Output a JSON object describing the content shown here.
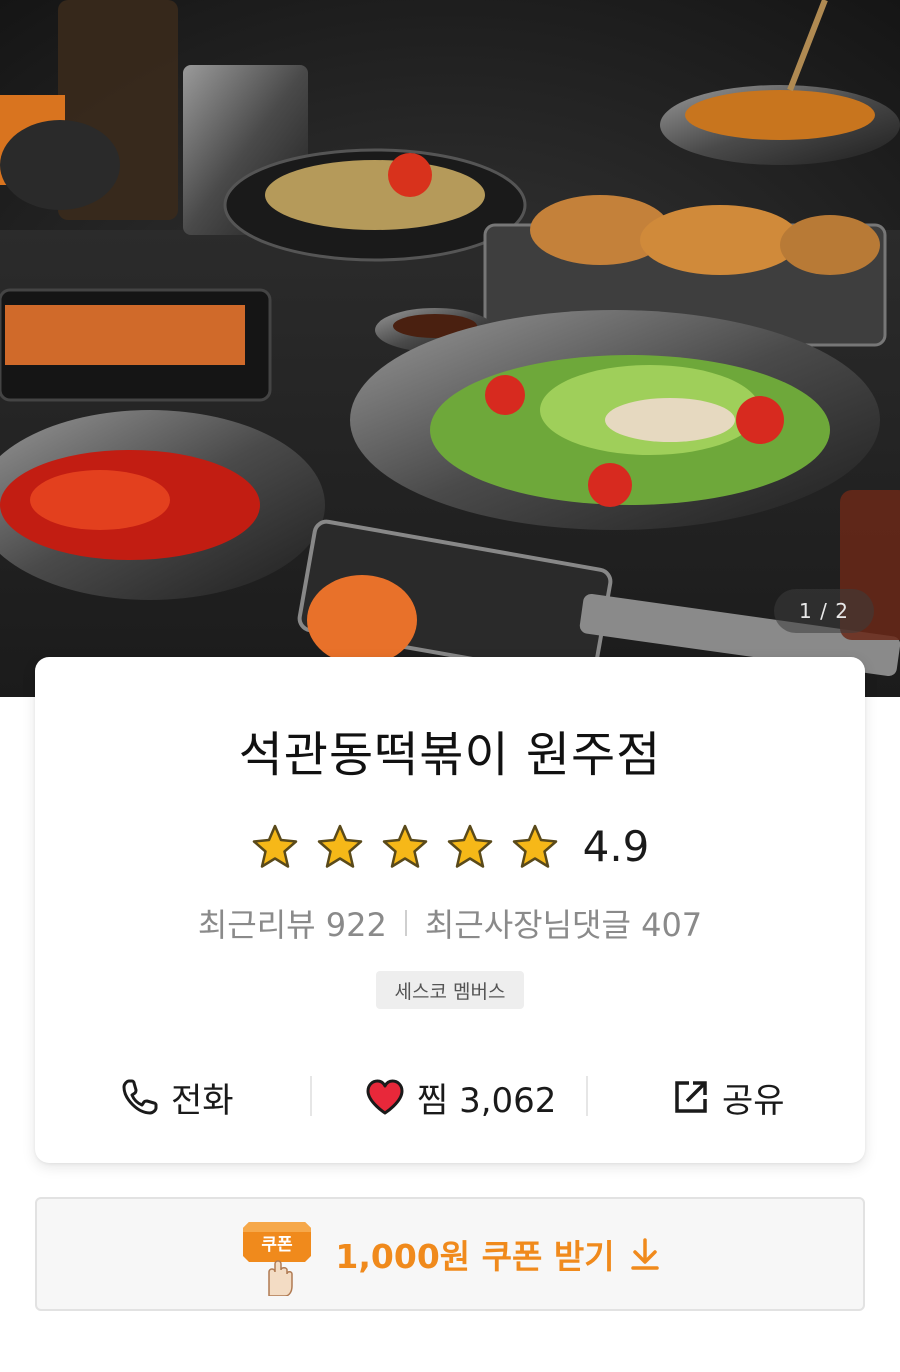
{
  "hero": {
    "page_indicator": "1 / 2"
  },
  "store": {
    "name": "석관동떡볶이 원주점",
    "rating": "4.9",
    "stars": 5,
    "recent_reviews_label": "최근리뷰 922",
    "owner_replies_label": "최근사장님댓글 407",
    "badge": "세스코 멤버스"
  },
  "actions": {
    "call_label": "전화",
    "like_label": "찜 3,062",
    "share_label": "공유"
  },
  "coupon": {
    "tag_text": "쿠폰",
    "label": "1,000원 쿠폰 받기"
  },
  "colors": {
    "accent_orange": "#f08a1c",
    "heart_red": "#e8283a",
    "star_yellow": "#f6b818"
  },
  "icons": {
    "call": "phone-icon",
    "like": "heart-icon",
    "share": "share-icon",
    "coupon_download": "download-arrow-icon",
    "rating_star": "star-icon"
  }
}
